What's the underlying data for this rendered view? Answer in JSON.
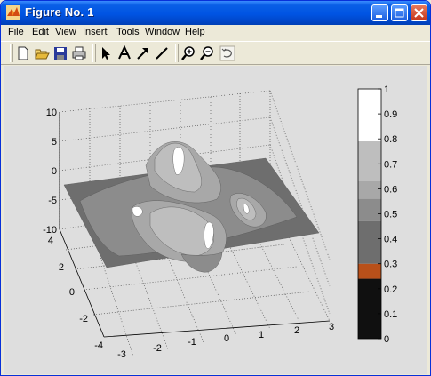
{
  "window": {
    "title": "Figure No. 1",
    "controls": [
      "minimize",
      "maximize",
      "close"
    ]
  },
  "menubar": {
    "items": [
      {
        "label": "File"
      },
      {
        "label": "Edit"
      },
      {
        "label": "View"
      },
      {
        "label": "Insert"
      },
      {
        "label": "Tools"
      },
      {
        "label": "Window"
      },
      {
        "label": "Help"
      }
    ]
  },
  "toolbar": {
    "tools": [
      "new-icon",
      "open-icon",
      "save-icon",
      "print-icon",
      "arrow-icon",
      "text-icon",
      "draw-arrow-icon",
      "line-icon",
      "zoom-in-icon",
      "zoom-out-icon",
      "rotate-icon"
    ]
  },
  "plot": {
    "z_ticks": [
      "10",
      "5",
      "0",
      "-5",
      "-10"
    ],
    "y_ticks": [
      "4",
      "2",
      "0",
      "-2",
      "-4"
    ],
    "x_ticks": [
      "-3",
      "-2",
      "-1",
      "0",
      "1",
      "2",
      "3"
    ],
    "colorbar": {
      "ticks": [
        "1",
        "0.9",
        "0.8",
        "0.7",
        "0.6",
        "0.5",
        "0.4",
        "0.3",
        "0.2",
        "0.1",
        "0"
      ],
      "bands": [
        {
          "from": 0.0,
          "to": 0.24,
          "color": "#101010"
        },
        {
          "from": 0.24,
          "to": 0.3,
          "color": "#b8501a"
        },
        {
          "from": 0.3,
          "to": 0.47,
          "color": "#6e6e6e"
        },
        {
          "from": 0.47,
          "to": 0.56,
          "color": "#8c8c8c"
        },
        {
          "from": 0.56,
          "to": 0.63,
          "color": "#a8a8a8"
        },
        {
          "from": 0.63,
          "to": 0.79,
          "color": "#bebebe"
        },
        {
          "from": 0.79,
          "to": 1.0,
          "color": "#ffffff"
        }
      ]
    }
  }
}
